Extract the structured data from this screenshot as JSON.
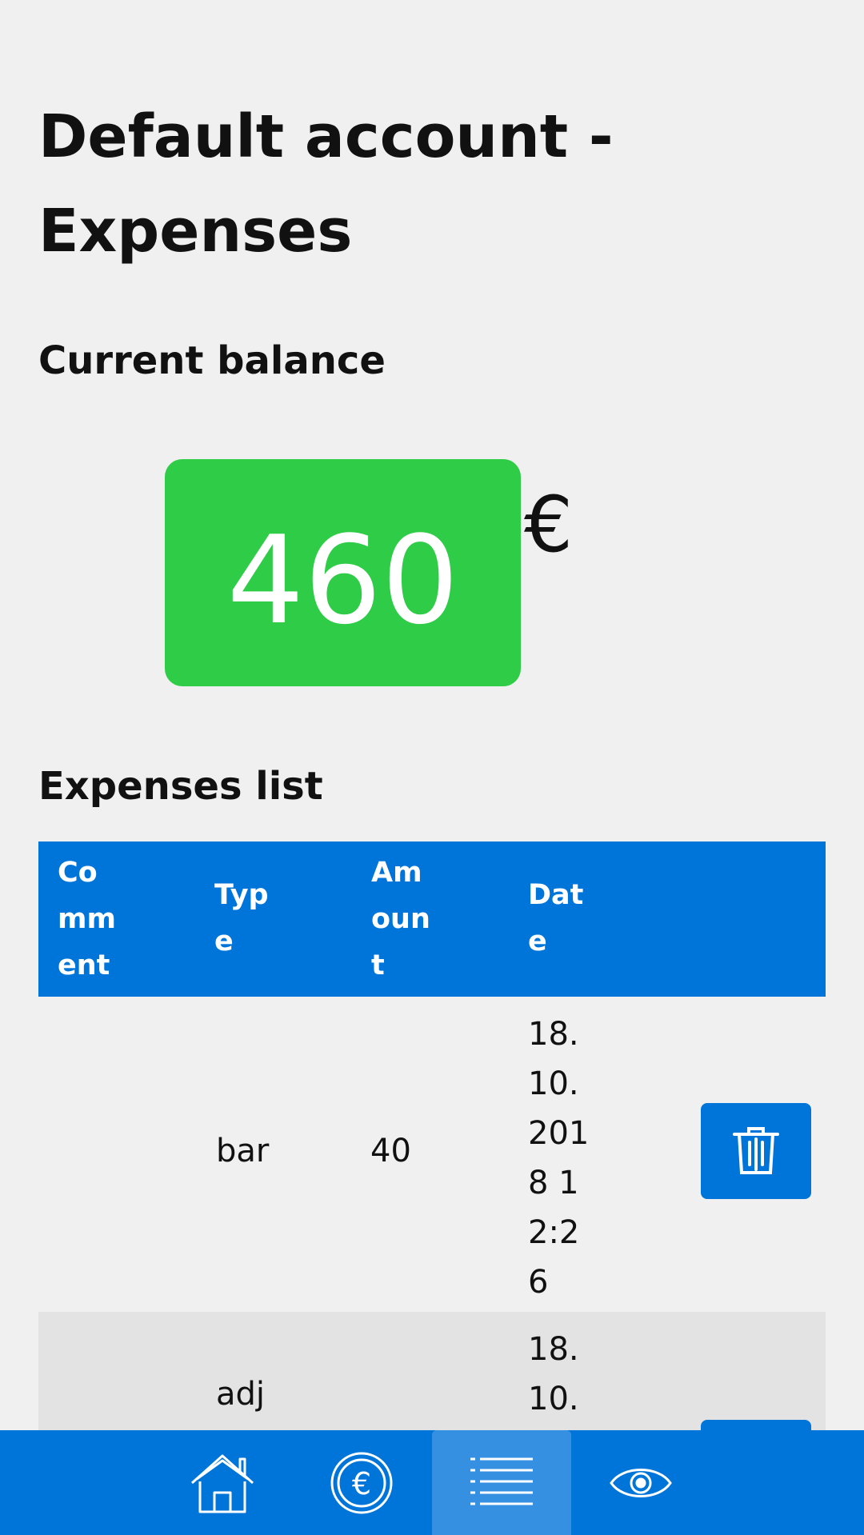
{
  "page": {
    "title": "Default account - Expenses",
    "balance_heading": "Current balance",
    "balance_value": "460",
    "currency_symbol": "€",
    "list_heading": "Expenses list"
  },
  "table": {
    "headers": [
      "Comment",
      "Type",
      "Amount",
      "Date"
    ],
    "rows": [
      {
        "comment": "",
        "type": "bar",
        "amount": "40",
        "date": "18.10.2018 12:26"
      },
      {
        "comment": "",
        "type": "adj",
        "amount": "",
        "date": "18.10."
      }
    ]
  },
  "colors": {
    "accent": "#0075d9",
    "balance_positive": "#2ecc47",
    "nav_active": "#3590e2"
  },
  "nav": [
    {
      "icon": "home-icon"
    },
    {
      "icon": "euro-icon"
    },
    {
      "icon": "list-icon",
      "active": true
    },
    {
      "icon": "eye-icon"
    }
  ]
}
